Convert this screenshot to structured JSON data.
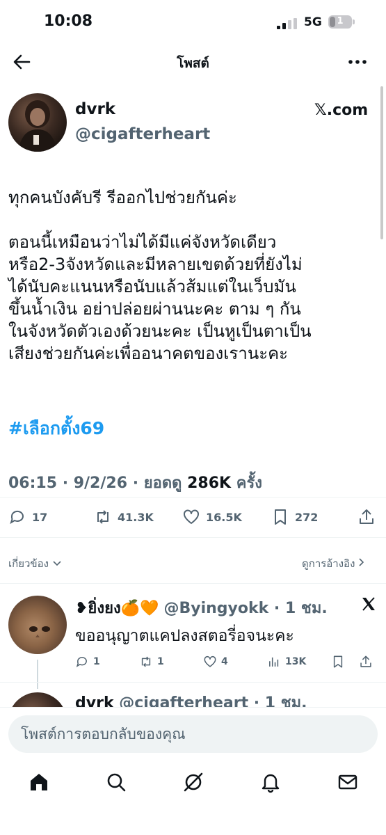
{
  "status_bar": {
    "time": "10:08",
    "network": "5G",
    "battery": "1"
  },
  "header": {
    "title": "โพสต์",
    "back_icon": "arrow-left-icon",
    "more_icon": "more-icon"
  },
  "post": {
    "author_name": "dvrk",
    "author_handle": "@cigafterheart",
    "source": "𝕏.com",
    "body": "ทุกคนบังคับรี รีออกไปช่วยกันค่ะ\n\nตอนนี้เหมือนว่าไม่ได้มีแค่จังหวัดเดียว\nหรือ2-3จังหวัดและมีหลายเขตด้วยที่ยังไม่\nได้นับคะแนนหรือนับแล้วส้มแต่ในเว็บมัน\nขึ้นน้ำเงิน อย่าปล่อยผ่านนะคะ ตาม ๆ กัน\nในจังหวัดตัวเองด้วยนะคะ เป็นหูเป็นตาเป็น\nเสียงช่วยกันค่ะเพื่ออนาคตของเรานะคะ",
    "hashtag": "#เลือกตั้ง69",
    "time": "06:15",
    "date": "9/2/26",
    "views_label": "ยอดดู",
    "views": "286K",
    "views_suffix": "ครั้ง",
    "replies": "17",
    "reposts": "41.3K",
    "likes": "16.5K",
    "bookmarks": "272"
  },
  "links": {
    "related": "เกี่ยวข้อง",
    "quotes": "ดูการอ้างอิง"
  },
  "replies": [
    {
      "name": "❥ยิ่งยง🍊🧡",
      "handle": "@Byingyokk",
      "time": "1 ชม.",
      "text": "ขออนุญาตแคปลงสตอรี่อจนะคะ",
      "replies": "1",
      "reposts": "1",
      "likes": "4",
      "views": "13K"
    },
    {
      "name": "dvrk",
      "handle": "@cigafterheart",
      "time": "1 ชม."
    }
  ],
  "compose": {
    "placeholder": "โพสต์การตอบกลับของคุณ"
  },
  "tabs": [
    "home-icon",
    "search-icon",
    "grok-icon",
    "notifications-icon",
    "messages-icon"
  ],
  "colors": {
    "accent": "#1d9bf0",
    "muted": "#536471",
    "text": "#0f1419"
  }
}
